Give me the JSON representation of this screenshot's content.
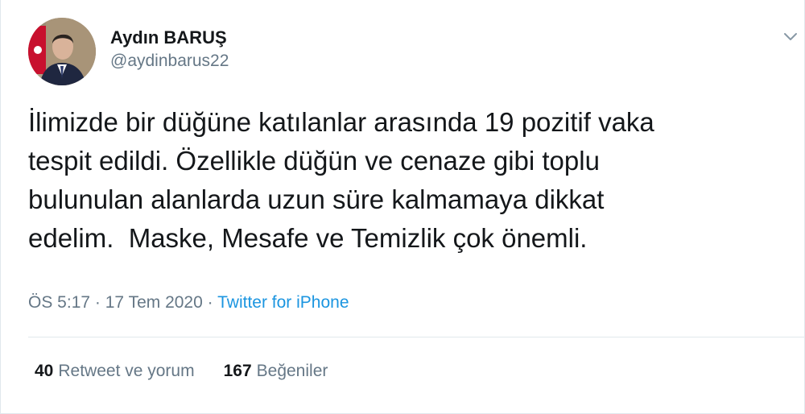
{
  "user": {
    "display_name": "Aydın BARUŞ",
    "handle": "@aydinbarus22"
  },
  "tweet": {
    "text": "İlimizde bir düğüne katılanlar arasında 19 pozitif vaka\ntespit edildi. Özellikle düğün ve cenaze gibi toplu\nbulunulan alanlarda uzun süre kalmamaya dikkat\nedelim.  Maske, Mesafe ve Temizlik çok önemli.",
    "time": "ÖS 5:17",
    "separator1": "·",
    "date": "17 Tem 2020",
    "separator2": "·",
    "source": "Twitter for iPhone"
  },
  "stats": {
    "retweets_count": "40",
    "retweets_label": "Retweet ve yorum",
    "likes_count": "167",
    "likes_label": "Beğeniler"
  },
  "icons": {
    "menu": "chevron-down-icon",
    "avatar": "profile-photo"
  },
  "colors": {
    "text": "#14171a",
    "secondary": "#657786",
    "link": "#1b95e0",
    "divider": "#e1e8ed"
  }
}
